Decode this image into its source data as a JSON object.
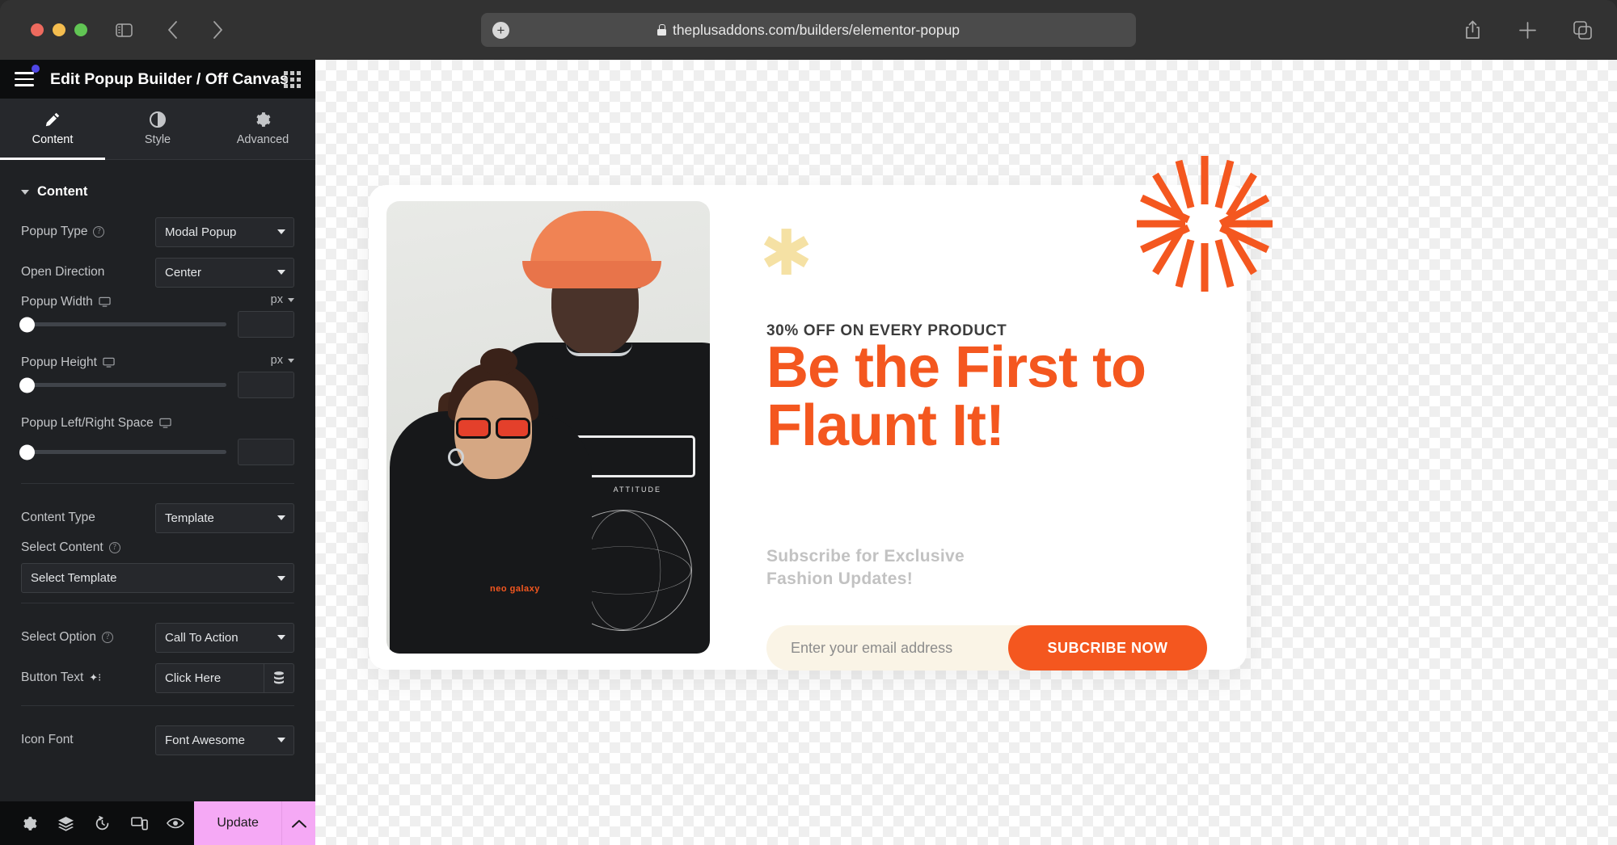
{
  "browser": {
    "url": "theplusaddons.com/builders/elementor-popup",
    "icons": {
      "sidebar": "sidebar-toggle-icon",
      "back": "back-chevron-icon",
      "forward": "forward-chevron-icon",
      "lock": "lock-icon",
      "plus_circle": "plus-circle-icon",
      "share": "share-icon",
      "new_tab": "plus-icon",
      "tab_overview": "tab-overview-icon"
    }
  },
  "panel": {
    "title": "Edit Popup Builder / Off Canvas",
    "tabs": [
      {
        "label": "Content",
        "icon": "pencil-icon",
        "active": true
      },
      {
        "label": "Style",
        "icon": "contrast-icon",
        "active": false
      },
      {
        "label": "Advanced",
        "icon": "gear-icon",
        "active": false
      }
    ],
    "section": {
      "title": "Content"
    },
    "fields": {
      "popup_type": {
        "label": "Popup Type",
        "value": "Modal Popup",
        "has_help": true
      },
      "open_direction": {
        "label": "Open Direction",
        "value": "Center",
        "has_help": false
      },
      "popup_width": {
        "label": "Popup Width",
        "unit": "px",
        "value": ""
      },
      "popup_height": {
        "label": "Popup Height",
        "unit": "px",
        "value": ""
      },
      "popup_lr_space": {
        "label": "Popup Left/Right Space",
        "value": ""
      },
      "content_type": {
        "label": "Content Type",
        "value": "Template"
      },
      "select_content": {
        "label": "Select Content",
        "value": "Select Template",
        "has_help": true
      },
      "select_option": {
        "label": "Select Option",
        "value": "Call To Action",
        "has_help": true
      },
      "button_text": {
        "label": "Button Text",
        "value": "Click Here"
      },
      "icon_font": {
        "label": "Icon Font",
        "value": "Font Awesome"
      }
    },
    "footer": {
      "icons": [
        "settings-gear-icon",
        "layers-icon",
        "history-icon",
        "responsive-icon",
        "preview-eye-icon"
      ],
      "update_label": "Update"
    }
  },
  "popup": {
    "eyebrow": "30% OFF ON EVERY PRODUCT",
    "headline": "Be the First to Flaunt It!",
    "subcopy": "Subscribe for Exclusive Fashion Updates!",
    "email_placeholder": "Enter your email address",
    "email_value": "",
    "subscribe_label": "SUBCRIBE NOW",
    "close_icon": "sunburst-close-icon",
    "decor_icon": "asterisk-icon"
  },
  "colors": {
    "accent_orange": "#F4571F",
    "cream": "#FAF4E6",
    "pale_yellow": "#F5E1A4",
    "update_pink": "#F5A9F5",
    "panel_bg": "#1F2124",
    "panel_header": "#0C0D0E"
  }
}
